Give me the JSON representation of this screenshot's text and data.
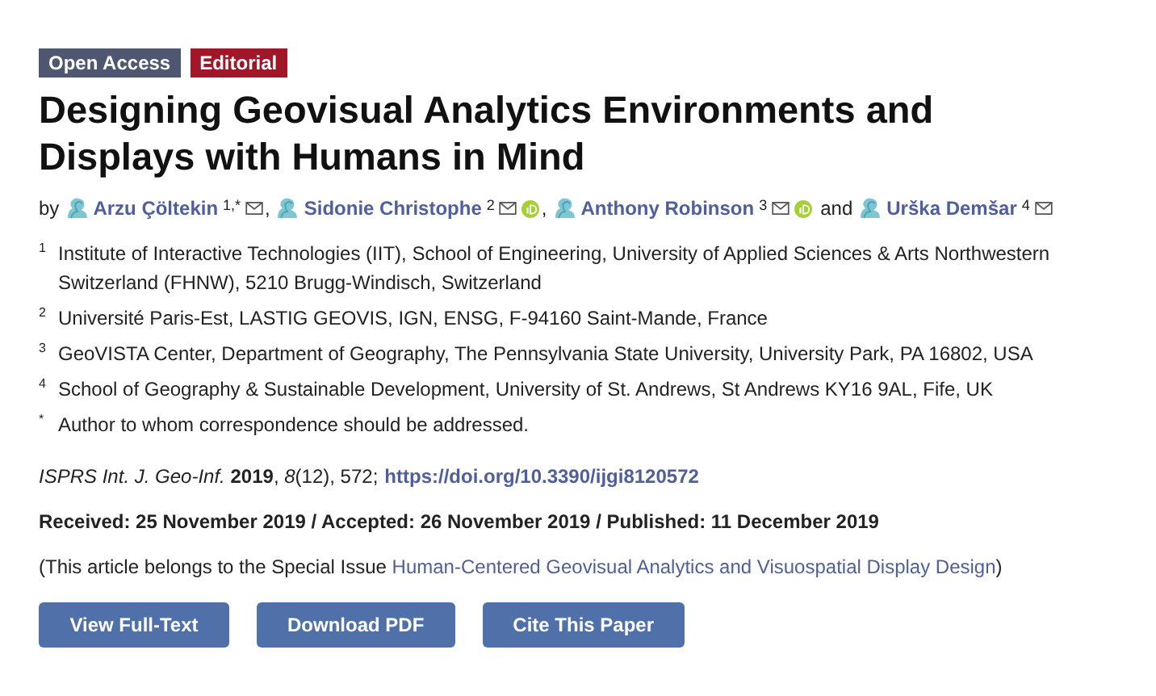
{
  "badges": [
    {
      "label": "Open Access",
      "color": "#4f5671"
    },
    {
      "label": "Editorial",
      "color": "#a0172a"
    }
  ],
  "title": "Designing Geovisual Analytics Environments and Displays with Humans in Mind",
  "byline": {
    "prefix": "by",
    "authors": [
      {
        "name": "Arzu Çöltekin",
        "sup": "1,*",
        "email": true,
        "orcid": false,
        "connector": ","
      },
      {
        "name": "Sidonie Christophe",
        "sup": "2",
        "email": true,
        "orcid": true,
        "connector": ","
      },
      {
        "name": "Anthony Robinson",
        "sup": "3",
        "email": true,
        "orcid": true,
        "connector": "and"
      },
      {
        "name": "Urška Demšar",
        "sup": "4",
        "email": true,
        "orcid": false
      }
    ]
  },
  "affiliations": [
    {
      "mark": "1",
      "text": "Institute of Interactive Technologies (IIT), School of Engineering, University of Applied Sciences & Arts Northwestern Switzerland (FHNW), 5210 Brugg-Windisch, Switzerland"
    },
    {
      "mark": "2",
      "text": "Université Paris-Est, LASTIG GEOVIS, IGN, ENSG, F-94160 Saint-Mande, France"
    },
    {
      "mark": "3",
      "text": "GeoVISTA Center, Department of Geography, The Pennsylvania State University, University Park, PA 16802, USA"
    },
    {
      "mark": "4",
      "text": "School of Geography & Sustainable Development, University of St. Andrews, St Andrews KY16 9AL, Fife, UK"
    },
    {
      "mark": "*",
      "text": "Author to whom correspondence should be addressed."
    }
  ],
  "citation": {
    "text": "*ISPRS Int. J. Geo-Inf.* **2019**, *8*(12), 572;",
    "doi": "https://doi.org/10.3390/ijgi8120572"
  },
  "dates": "Received: 25 November 2019 / Accepted: 26 November 2019 / Published: 11 December 2019",
  "special_issue": {
    "prefix": "(This article belongs to the Special Issue",
    "link": "Human-Centered Geovisual Analytics and Visuospatial Display Design",
    "suffix": ")"
  },
  "buttons": [
    "View Full-Text",
    "Download PDF",
    "Cite This Paper"
  ]
}
